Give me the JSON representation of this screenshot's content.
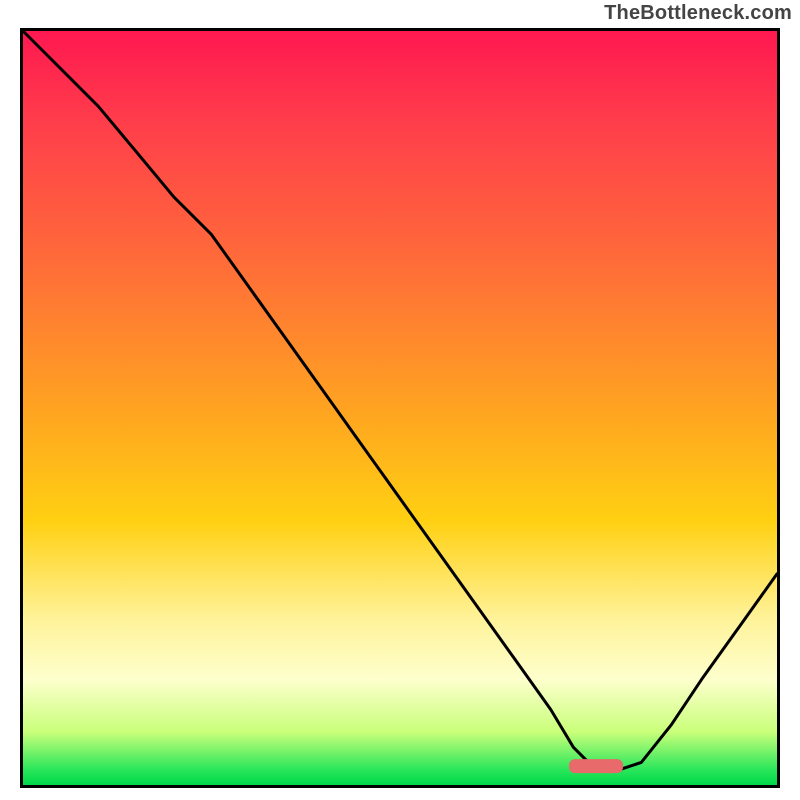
{
  "attribution": "TheBottleneck.com",
  "chart_data": {
    "type": "line",
    "title": "",
    "xlabel": "",
    "ylabel": "",
    "xlim": [
      0,
      100
    ],
    "ylim": [
      0,
      100
    ],
    "grid": false,
    "legend": false,
    "annotations": [
      {
        "kind": "marker",
        "shape": "rounded-bar",
        "x": 76,
        "y": 2.5,
        "color": "#e86a6a"
      }
    ],
    "series": [
      {
        "name": "curve",
        "color": "#000000",
        "x": [
          0,
          5,
          10,
          15,
          20,
          25,
          30,
          35,
          40,
          45,
          50,
          55,
          60,
          65,
          70,
          73,
          76,
          79,
          82,
          86,
          90,
          95,
          100
        ],
        "y": [
          100,
          95,
          90,
          84,
          78,
          73,
          66,
          59,
          52,
          45,
          38,
          31,
          24,
          17,
          10,
          5,
          2,
          2,
          3,
          8,
          14,
          21,
          28
        ]
      }
    ],
    "background_gradient": {
      "direction": "vertical",
      "stops": [
        {
          "pos": 0.0,
          "color": "#ff1850"
        },
        {
          "pos": 0.12,
          "color": "#ff3d4b"
        },
        {
          "pos": 0.3,
          "color": "#ff6a3a"
        },
        {
          "pos": 0.5,
          "color": "#ffa321"
        },
        {
          "pos": 0.65,
          "color": "#ffd012"
        },
        {
          "pos": 0.78,
          "color": "#fff39a"
        },
        {
          "pos": 0.86,
          "color": "#fdffcc"
        },
        {
          "pos": 0.93,
          "color": "#c9ff7a"
        },
        {
          "pos": 0.98,
          "color": "#29e65a"
        },
        {
          "pos": 1.0,
          "color": "#00d84a"
        }
      ]
    }
  }
}
